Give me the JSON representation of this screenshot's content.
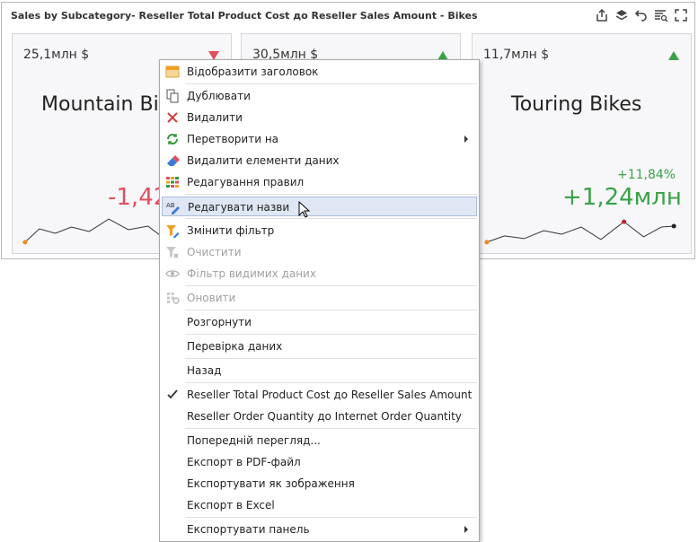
{
  "dashboard": {
    "title": "Sales by Subcategory- Reseller Total Product Cost до Reseller Sales Amount - Bikes",
    "toolbar": [
      "export-icon",
      "layers-icon",
      "undo-icon",
      "filter-list-icon",
      "maximize-icon"
    ]
  },
  "cards": [
    {
      "value": "25,1млн $",
      "name": "Mountain Bikes",
      "delta": "-1,42",
      "trend": "down",
      "color": "#e0505c"
    },
    {
      "value": "30,5млн $",
      "trend": "up",
      "color": "#3aa247"
    },
    {
      "value": "11,7млн $",
      "name": "Touring Bikes",
      "percent": "+11,84%",
      "delta": "+1,24млн",
      "trend": "up",
      "color": "#3aa247"
    }
  ],
  "menu": {
    "items": [
      {
        "label": "Відобразити заголовок",
        "icon": "show-caption-icon",
        "disabled": false
      },
      {
        "label": "Дублювати",
        "icon": "duplicate-icon",
        "disabled": false
      },
      {
        "label": "Видалити",
        "icon": "delete-icon",
        "disabled": false
      },
      {
        "label": "Перетворити на",
        "icon": "convert-icon",
        "disabled": false,
        "submenu": true
      },
      {
        "label": "Видалити елементи даних",
        "icon": "remove-data-items-icon",
        "disabled": false
      },
      {
        "label": "Редагування правил",
        "icon": "edit-rules-icon",
        "disabled": false
      },
      {
        "label": "Редагувати назви",
        "icon": "edit-names-icon",
        "disabled": false,
        "hover": true
      },
      {
        "label": "Змінити фільтр",
        "icon": "edit-filter-icon",
        "disabled": false
      },
      {
        "label": "Очистити",
        "icon": "clear-filter-icon",
        "disabled": true
      },
      {
        "label": "Фільтр видимих даних",
        "icon": "visible-data-filter-icon",
        "disabled": true
      },
      {
        "label": "Оновити",
        "icon": "refresh-icon",
        "disabled": true
      },
      {
        "label": "Розгорнути",
        "disabled": false
      },
      {
        "label": "Перевірка даних",
        "disabled": false
      },
      {
        "label": "Назад",
        "disabled": false
      },
      {
        "label": "Reseller Total Product Cost до Reseller Sales Amount",
        "icon": "check-icon",
        "disabled": false,
        "checked": true
      },
      {
        "label": "Reseller Order Quantity до Internet Order Quantity",
        "disabled": false
      },
      {
        "label": "Попередній перегляд...",
        "disabled": false
      },
      {
        "label": "Експорт в PDF-файл",
        "disabled": false
      },
      {
        "label": "Експортувати як зображення",
        "disabled": false
      },
      {
        "label": "Експорт в Excel",
        "disabled": false
      },
      {
        "label": "Експортувати панель",
        "disabled": false,
        "submenu": true
      }
    ]
  }
}
